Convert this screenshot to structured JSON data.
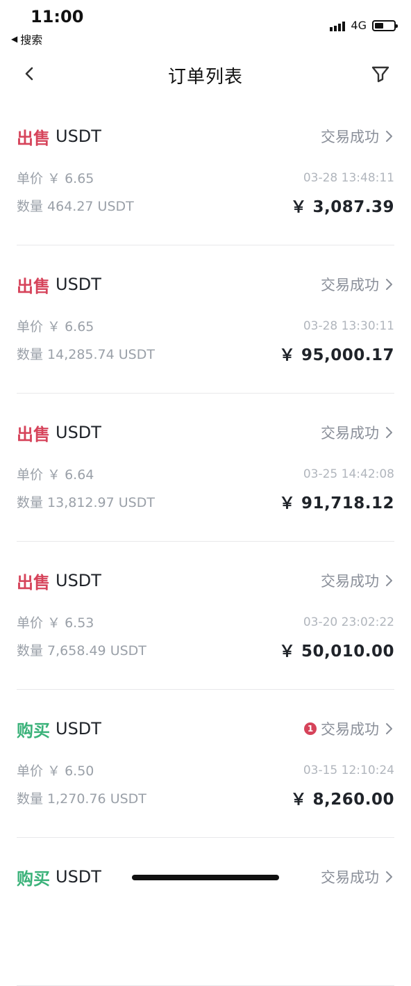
{
  "status_bar": {
    "time": "11:00",
    "back_label": "搜索",
    "network": "4G"
  },
  "nav": {
    "title": "订单列表",
    "back_icon": "chevron-left-icon",
    "filter_icon": "filter-icon"
  },
  "orders": [
    {
      "type": "出售",
      "kind": "sell",
      "asset": "USDT",
      "status": "交易成功",
      "badge": "",
      "price": "单价 ￥ 6.65",
      "time": "03-28 13:48:11",
      "qty": "数量 464.27 USDT",
      "total": "￥ 3,087.39"
    },
    {
      "type": "出售",
      "kind": "sell",
      "asset": "USDT",
      "status": "交易成功",
      "badge": "",
      "price": "单价 ￥ 6.65",
      "time": "03-28 13:30:11",
      "qty": "数量 14,285.74 USDT",
      "total": "￥ 95,000.17"
    },
    {
      "type": "出售",
      "kind": "sell",
      "asset": "USDT",
      "status": "交易成功",
      "badge": "",
      "price": "单价 ￥ 6.64",
      "time": "03-25 14:42:08",
      "qty": "数量 13,812.97 USDT",
      "total": "￥ 91,718.12"
    },
    {
      "type": "出售",
      "kind": "sell",
      "asset": "USDT",
      "status": "交易成功",
      "badge": "",
      "price": "单价 ￥ 6.53",
      "time": "03-20 23:02:22",
      "qty": "数量 7,658.49 USDT",
      "total": "￥ 50,010.00"
    },
    {
      "type": "购买",
      "kind": "buy",
      "asset": "USDT",
      "status": "交易成功",
      "badge": "1",
      "price": "单价 ￥ 6.50",
      "time": "03-15 12:10:24",
      "qty": "数量 1,270.76 USDT",
      "total": "￥ 8,260.00"
    },
    {
      "type": "购买",
      "kind": "buy",
      "asset": "USDT",
      "status": "交易成功",
      "badge": "",
      "price": "",
      "time": "",
      "qty": "",
      "total": ""
    }
  ],
  "colors": {
    "sell": "#d6435a",
    "buy": "#3bb27a",
    "muted": "#8a8f99",
    "divider": "#e8e8ea"
  }
}
